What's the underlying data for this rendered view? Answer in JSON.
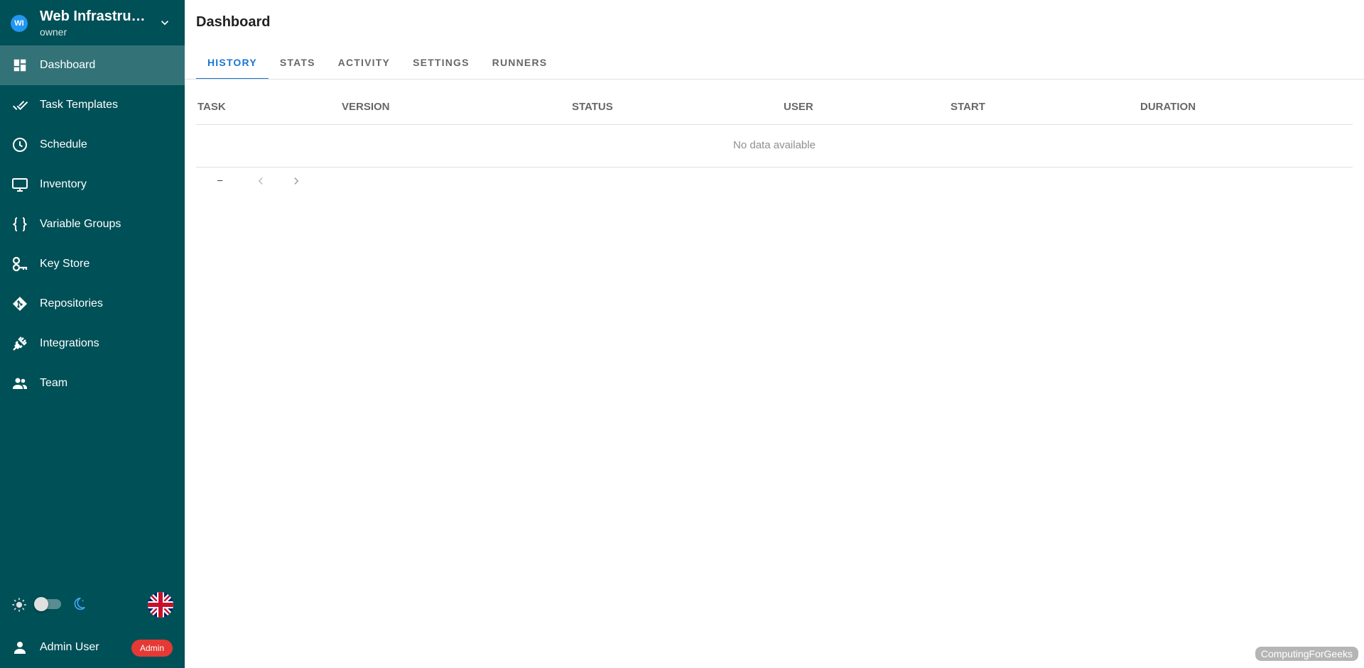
{
  "project": {
    "avatar_text": "WI",
    "name": "Web Infrastruc...",
    "role": "owner"
  },
  "sidebar": {
    "items": [
      {
        "label": "Dashboard",
        "icon": "dashboard-icon",
        "active": true
      },
      {
        "label": "Task Templates",
        "icon": "check-all-icon"
      },
      {
        "label": "Schedule",
        "icon": "clock-icon"
      },
      {
        "label": "Inventory",
        "icon": "monitor-icon"
      },
      {
        "label": "Variable Groups",
        "icon": "braces-icon"
      },
      {
        "label": "Key Store",
        "icon": "key-icon"
      },
      {
        "label": "Repositories",
        "icon": "git-icon"
      },
      {
        "label": "Integrations",
        "icon": "plug-icon"
      },
      {
        "label": "Team",
        "icon": "people-icon"
      }
    ]
  },
  "user": {
    "name": "Admin User",
    "badge": "Admin"
  },
  "page": {
    "title": "Dashboard"
  },
  "tabs": [
    {
      "label": "HISTORY",
      "active": true
    },
    {
      "label": "STATS"
    },
    {
      "label": "ACTIVITY"
    },
    {
      "label": "SETTINGS"
    },
    {
      "label": "RUNNERS"
    }
  ],
  "table": {
    "columns": [
      "TASK",
      "VERSION",
      "STATUS",
      "USER",
      "START",
      "DURATION"
    ],
    "empty_text": "No data available"
  },
  "pager": {
    "range": "–"
  },
  "watermark": "ComputingForGeeks",
  "colors": {
    "sidebar": "#005057",
    "accent": "#1976d2",
    "badge": "#e53935"
  }
}
